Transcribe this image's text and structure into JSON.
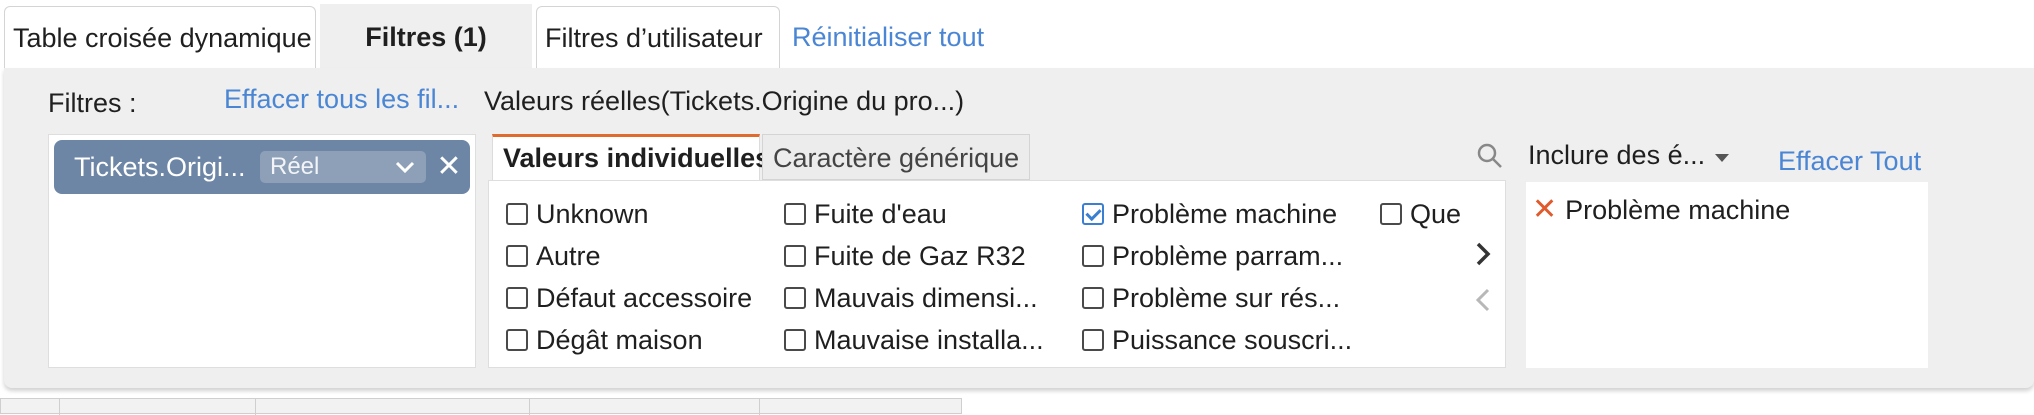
{
  "tabs": {
    "pivot": "Table croisée dynamique",
    "filters": "Filtres  (1)",
    "user_filters": "Filtres d’utilisateur",
    "reset_all": "Réinitialiser tout"
  },
  "panel": {
    "filters_label": "Filtres :",
    "clear_all_filters": "Effacer tous les fil...",
    "actual_values_title": "Valeurs réelles(Tickets.Origine du pro...)"
  },
  "chip": {
    "field": "Tickets.Origi...",
    "mode": "Réel"
  },
  "value_tabs": {
    "individual": "Valeurs individuelles",
    "wildcard": "Caractère générique"
  },
  "values": [
    {
      "label": "Unknown",
      "checked": false
    },
    {
      "label": "Autre",
      "checked": false
    },
    {
      "label": "Défaut accessoire",
      "checked": false
    },
    {
      "label": "Dégât maison",
      "checked": false
    },
    {
      "label": "Fuite d'eau",
      "checked": false
    },
    {
      "label": "Fuite de Gaz R32",
      "checked": false
    },
    {
      "label": "Mauvais dimensi...",
      "checked": false
    },
    {
      "label": "Mauvaise installa...",
      "checked": false
    },
    {
      "label": "Problème machine",
      "checked": true
    },
    {
      "label": "Problème parram...",
      "checked": false
    },
    {
      "label": "Problème sur rés...",
      "checked": false
    },
    {
      "label": "Puissance souscri...",
      "checked": false
    },
    {
      "label": "Que",
      "checked": false
    }
  ],
  "include": {
    "dropdown": "Inclure des é...",
    "clear_all": "Effacer Tout",
    "selected": [
      "Problème machine"
    ]
  },
  "icons": {
    "search": "search-icon",
    "next": "chevron-right-icon",
    "prev": "chevron-left-icon",
    "remove": "close-icon"
  },
  "colors": {
    "accent_link": "#4a86d4",
    "active_tab_border": "#e06b2e",
    "chip_bg": "#6d86a6",
    "remove_x": "#e05a2b"
  }
}
